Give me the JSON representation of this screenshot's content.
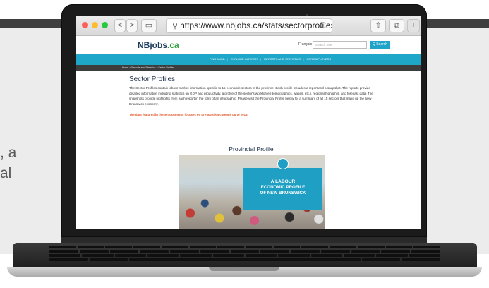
{
  "background": {
    "text_lines": [
      ", a",
      "al"
    ]
  },
  "browser": {
    "address": "https://www.nbjobs.ca/stats/sectorprofiles",
    "back_glyph": "<",
    "forward_glyph": ">",
    "sidebar_glyph": "▭",
    "share_glyph": "⇧",
    "tabs_glyph": "⧉",
    "new_tab_glyph": "+",
    "reload_glyph": "C",
    "search_glyph": "⚲"
  },
  "site": {
    "logo_main": "NBjobs",
    "logo_suffix": ".ca",
    "language_link": "Français",
    "search_placeholder": "Search Site",
    "search_button": "Q Search",
    "nav": [
      "FIND A JOB",
      "EXPLORE CAREERS",
      "REPORTS AND STATISTICS",
      "FOR EMPLOYERS"
    ],
    "breadcrumb": "Home  >  Reports and Statistics  >  Sector Profiles"
  },
  "content": {
    "heading": "Sector Profiles",
    "intro": "The Sector Profiles contain labour market information specific to 15 economic sectors in the province. Each profile includes a report and a snapshot. The reports provide detailed information including statistics on GDP and productivity, a profile of the sector's workforce (demographics, wages, etc.), regional highlights, and forecast data. The snapshots provide highlights from each report in the form of an infographic. Please visit the Provincial Profile below for a summary of all 15 sectors that make up the New Brunswick economy.",
    "alert": "The data featured in these documents focuses on pre-pandemic trends up to 2019.",
    "provincial_heading": "Provincial Profile",
    "banner_line1": "A LABOUR",
    "banner_line2": "ECONOMIC PROFILE",
    "banner_line3": "OF NEW BRUNSWICK"
  },
  "colors": {
    "nav_bar": "#1fa7c9",
    "breadcrumb_bar": "#3d3d3d",
    "alert_text": "#e2582a",
    "logo_green": "#2e9f3c"
  }
}
